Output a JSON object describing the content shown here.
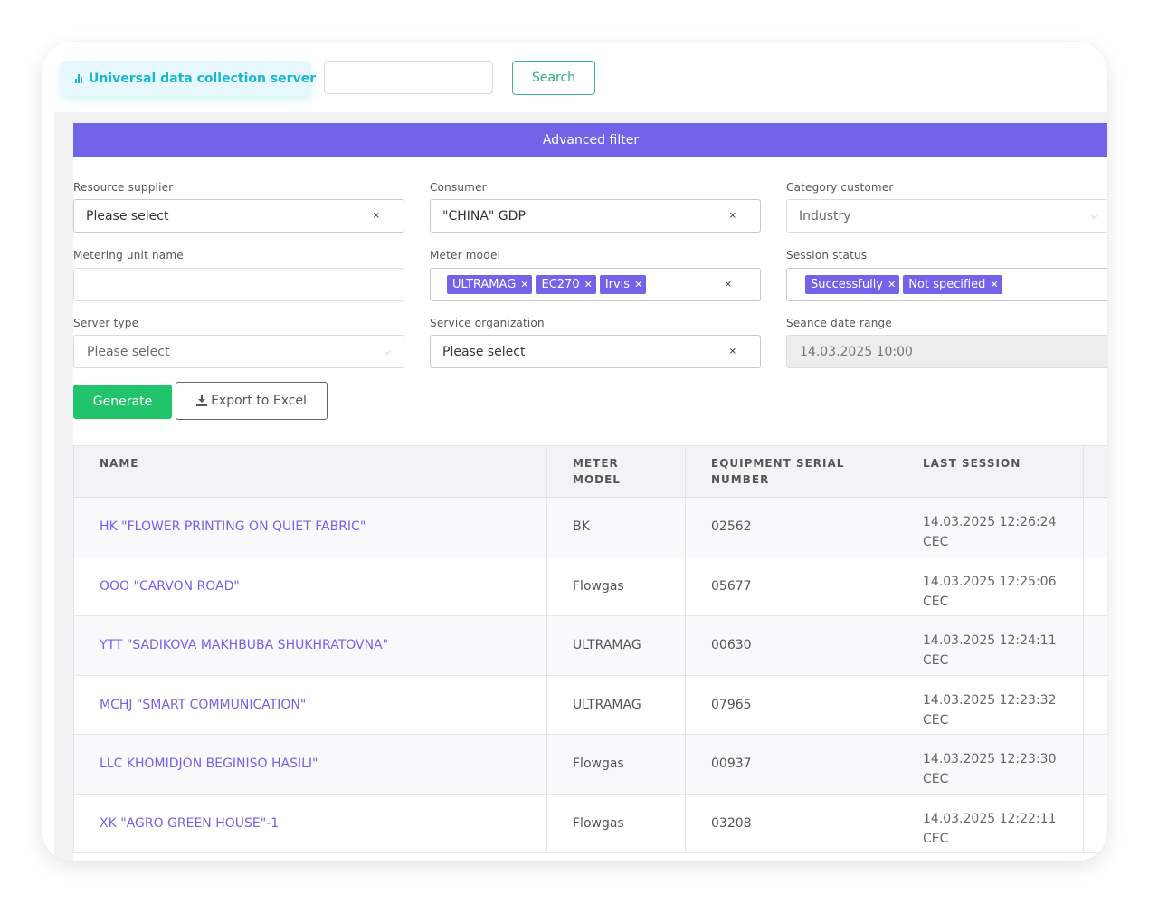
{
  "header": {
    "brand": "Universal data collection server",
    "search_value": "",
    "search_button": "Search"
  },
  "filter": {
    "title": "Advanced filter",
    "resource_supplier": {
      "label": "Resource supplier",
      "value": "Please select"
    },
    "consumer": {
      "label": "Consumer",
      "value": "\"CHINA\" GDP"
    },
    "category_customer": {
      "label": "Category customer",
      "value": "Industry"
    },
    "metering_unit_name": {
      "label": "Metering unit name",
      "value": ""
    },
    "meter_model": {
      "label": "Meter model",
      "tags": [
        "ULTRAMAG",
        "EC270",
        "Irvis"
      ]
    },
    "session_status": {
      "label": "Session status",
      "tags": [
        "Successfully",
        "Not specified"
      ]
    },
    "server_type": {
      "label": "Server type",
      "value": "Please select"
    },
    "service_organization": {
      "label": "Service organization",
      "value": "Please select"
    },
    "seance_date_range": {
      "label": "Seance date range",
      "value": "14.03.2025 10:00"
    }
  },
  "actions": {
    "generate": "Generate",
    "export": "Export to Excel"
  },
  "table": {
    "columns": {
      "name": "NAME",
      "meter_model_l1": "METER",
      "meter_model_l2": "MODEL",
      "serial_l1": "EQUIPMENT SERIAL",
      "serial_l2": "NUMBER",
      "last_session": "LAST SESSION"
    },
    "rows": [
      {
        "name": "HK \"FLOWER PRINTING ON QUIET FABRIC\"",
        "model": "BK",
        "serial": "02562",
        "session": "14.03.2025 12:26:24",
        "tz": "CEC"
      },
      {
        "name": "OOO \"CARVON ROAD\"",
        "model": "Flowgas",
        "serial": "05677",
        "session": "14.03.2025 12:25:06",
        "tz": "CEC"
      },
      {
        "name": "YTT \"SADIKOVA MAKHBUBA SHUKHRATOVNA\"",
        "model": "ULTRAMAG",
        "serial": "00630",
        "session": "14.03.2025 12:24:11",
        "tz": "CEC"
      },
      {
        "name": "MCHJ \"SMART COMMUNICATION\"",
        "model": "ULTRAMAG",
        "serial": "07965",
        "session": "14.03.2025 12:23:32",
        "tz": "CEC"
      },
      {
        "name": "LLC KHOMIDJON BEGINISO HASILI\"",
        "model": "Flowgas",
        "serial": "00937",
        "session": "14.03.2025 12:23:30",
        "tz": "CEC"
      },
      {
        "name": "XK \"AGRO GREEN HOUSE\"-1",
        "model": "Flowgas",
        "serial": "03208",
        "session": "14.03.2025 12:22:11",
        "tz": "CEC"
      }
    ]
  },
  "colors": {
    "accent": "#7263e8",
    "brand": "#19b7ce",
    "success": "#21c46b"
  }
}
